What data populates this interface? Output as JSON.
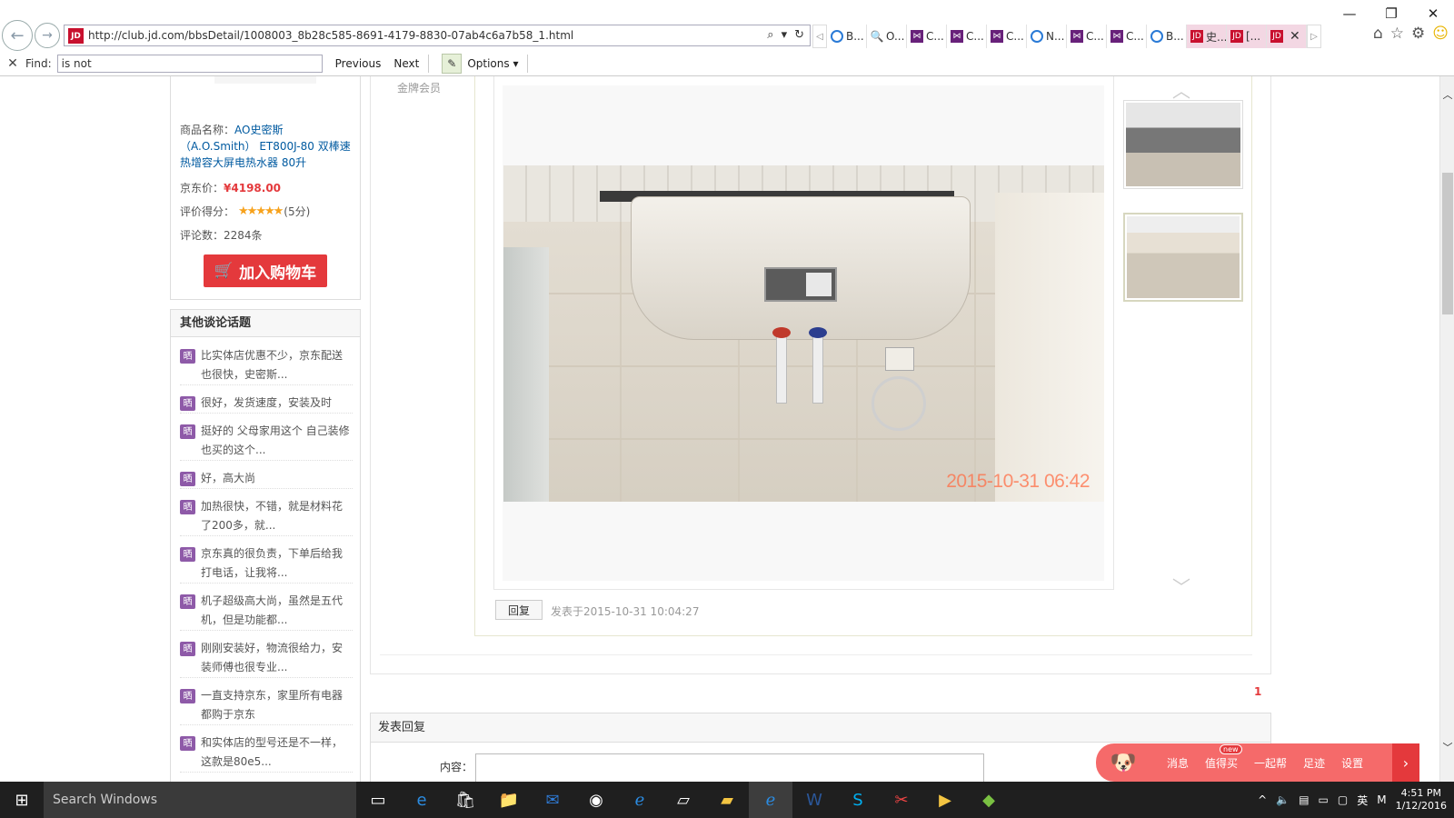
{
  "browser": {
    "url": "http://club.jd.com/bbsDetail/1008003_8b28c585-8691-4179-8830-07ab4c6a7b58_1.html",
    "site_icon_text": "JD",
    "tabs": [
      {
        "icon": "ie-icon",
        "label": "B..."
      },
      {
        "icon": "search-icon",
        "label": "O..."
      },
      {
        "icon": "vs-icon",
        "label": "C..."
      },
      {
        "icon": "vs-icon",
        "label": "C..."
      },
      {
        "icon": "vs-icon",
        "label": "C..."
      },
      {
        "icon": "ie-icon",
        "label": "N..."
      },
      {
        "icon": "vs-icon",
        "label": "C..."
      },
      {
        "icon": "vs-icon",
        "label": "C..."
      },
      {
        "icon": "ie-icon",
        "label": "B..."
      },
      {
        "icon": "jd-icon",
        "label": "史..."
      },
      {
        "icon": "jd-icon",
        "label": "[..."
      },
      {
        "icon": "jd-icon",
        "label": ""
      }
    ],
    "find": {
      "label": "Find:",
      "value": "is not",
      "previous": "Previous",
      "next": "Next",
      "options": "Options"
    }
  },
  "product": {
    "name_label": "商品名称：",
    "name": "AO史密斯（A.O.Smith） ET800J-80 双棒速热增容大屏电热水器 80升",
    "price_label": "京东价：",
    "price": "¥4198.00",
    "score_label": "评价得分：",
    "stars": "★★★★★",
    "score": "(5分)",
    "count_label": "评论数：",
    "count": "2284条",
    "cart_button": "加入购物车"
  },
  "topics": {
    "title": "其他谈论话题",
    "badge": "晒",
    "items": [
      "比实体店优惠不少，京东配送也很快，史密斯...",
      "很好，发货速度，安装及时",
      "挺好的 父母家用这个 自己装修也买的这个...",
      "好，高大尚",
      "加热很快，不错，就是材料花了200多，就...",
      "京东真的很负责，下单后给我打电话，让我将...",
      "机子超级高大尚，虽然是五代机，但是功能都...",
      "刚刚安装好，物流很给力，安装师傅也很专业...",
      "一直支持京东，家里所有电器都购于京东",
      "和实体店的型号还是不一样，这款是80e5..."
    ]
  },
  "post": {
    "user_level": "金牌会员",
    "photo_timestamp": "2015-10-31  06:42",
    "reply_button": "回复",
    "posted_at": "发表于2015-10-31 10:04:27"
  },
  "pagination": {
    "current": "1"
  },
  "reply_panel": {
    "title": "发表回复",
    "content_label": "内容："
  },
  "float_bar": {
    "items": [
      "消息",
      "值得买",
      "一起帮",
      "足迹",
      "设置"
    ],
    "new_badge": "new"
  },
  "taskbar": {
    "search_placeholder": "Search Windows",
    "time": "4:51 PM",
    "date": "1/12/2016",
    "ime": "英"
  }
}
